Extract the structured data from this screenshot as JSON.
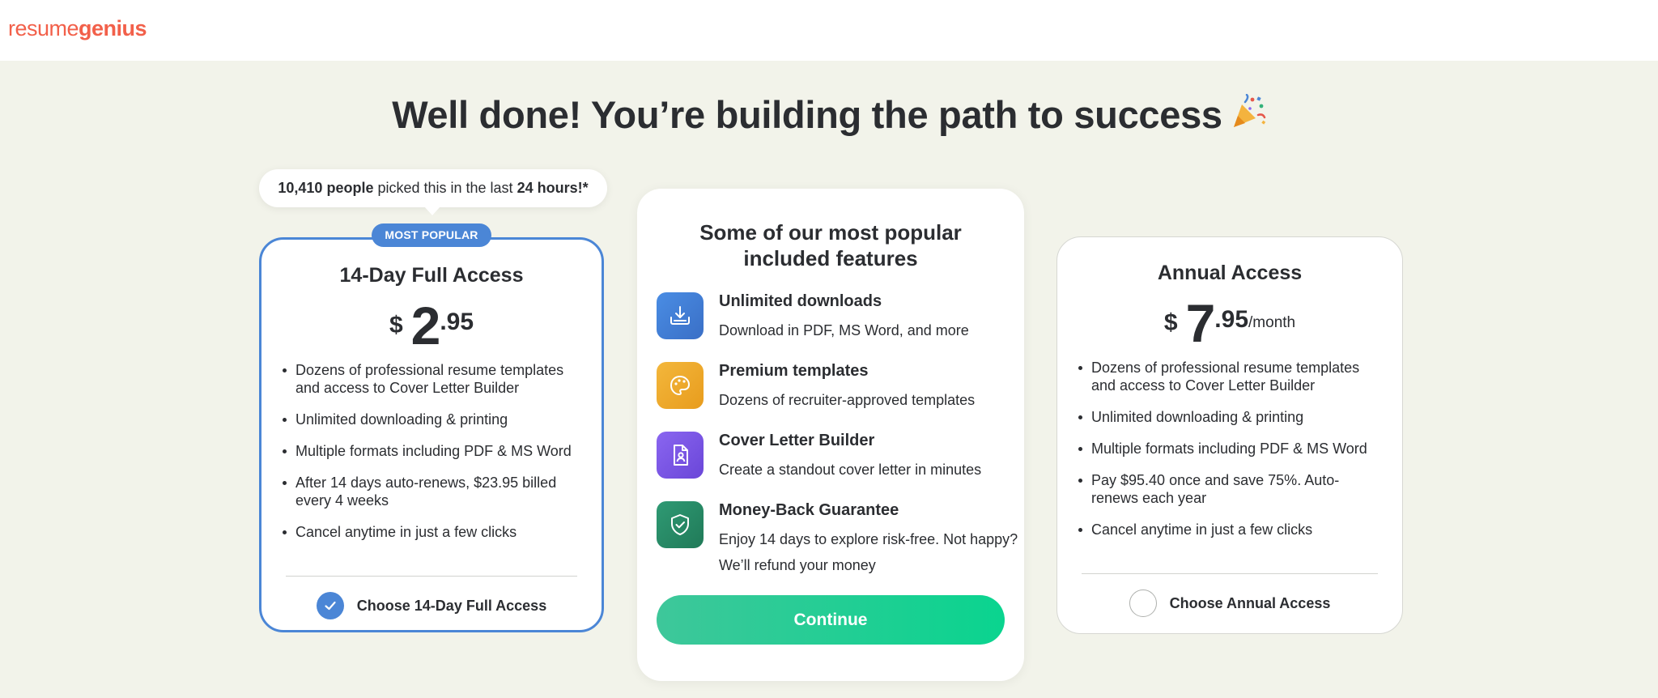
{
  "header": {
    "logo_part1": "resume",
    "logo_part2": "genius"
  },
  "headline": "Well done! You’re building the path to success",
  "social_proof": {
    "count": "10,410 people",
    "middle": " picked this in the last ",
    "window": "24 hours!*"
  },
  "plans": [
    {
      "badge": "MOST POPULAR",
      "title": "14-Day Full Access",
      "currency": "$",
      "price_whole": "2",
      "price_cents": ".95",
      "price_suffix": "",
      "features": [
        "Dozens of professional resume templates and access to Cover Letter Builder",
        "Unlimited downloading & printing",
        "Multiple formats including PDF & MS Word",
        "After 14 days auto-renews, $23.95 billed every 4 weeks",
        "Cancel anytime in just a few clicks"
      ],
      "choose_label": "Choose 14-Day Full Access",
      "selected": true
    },
    {
      "title": "Annual Access",
      "currency": "$",
      "price_whole": "7",
      "price_cents": ".95",
      "price_suffix": "/month",
      "features": [
        "Dozens of professional resume templates and access to Cover Letter Builder",
        "Unlimited downloading & printing",
        "Multiple formats including PDF & MS Word",
        "Pay $95.40 once and save 75%. Auto-renews each year",
        "Cancel anytime in just a few clicks"
      ],
      "choose_label": "Choose Annual Access",
      "selected": false
    }
  ],
  "features_panel": {
    "title_line1": "Some of our most popular",
    "title_line2": "included features",
    "items": [
      {
        "icon": "download-icon",
        "color": "#3f7ed8",
        "title": "Unlimited downloads",
        "desc": "Download in PDF, MS Word, and more"
      },
      {
        "icon": "palette-icon",
        "color": "#f0ab2e",
        "title": "Premium templates",
        "desc": "Dozens of recruiter-approved templates"
      },
      {
        "icon": "document-person-icon",
        "color": "#7a57e6",
        "title": "Cover Letter Builder",
        "desc": "Create a standout cover letter in minutes"
      },
      {
        "icon": "shield-check-icon",
        "color": "#268763",
        "title": "Money-Back Guarantee",
        "desc": "Enjoy 14 days to explore risk-free. Not happy? We’ll refund your money"
      }
    ],
    "cta": "Continue"
  },
  "colors": {
    "brand": "#f2604a",
    "accent_blue": "#4b86d6",
    "cta_green": "#0ad48f",
    "page_bg": "#f2f3ea"
  }
}
